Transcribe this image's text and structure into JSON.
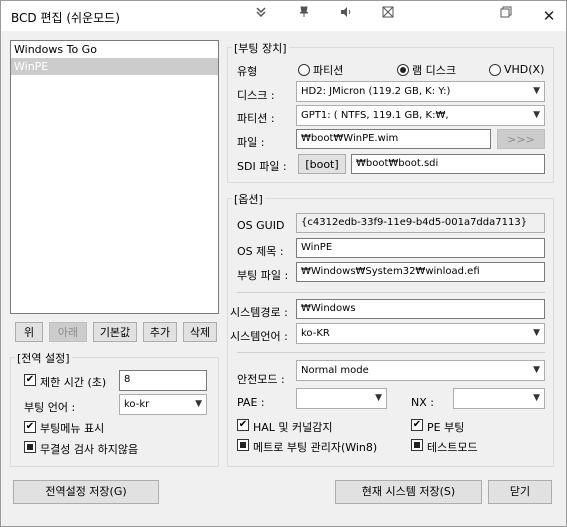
{
  "window": {
    "title": "BCD 편집 (쉬운모드)",
    "close": "✕"
  },
  "toolbar_icons": [
    "double-down-icon",
    "pin-icon",
    "speaker-icon",
    "screen-icon",
    "restore-icon"
  ],
  "entries": [
    "Windows To Go",
    "WinPE"
  ],
  "list_buttons": {
    "up": "위",
    "down": "아래",
    "default": "기본값",
    "add": "추가",
    "delete": "삭제"
  },
  "global_settings": {
    "title": "[전역 설정]",
    "timeout_label": "제한 시간 (초)",
    "timeout_value": "8",
    "lang_label": "부팅 언어 :",
    "lang_value": "ko-kr",
    "show_menu_label": "부팅메뉴 표시",
    "no_integrity_label": "무결성 검사 하지않음"
  },
  "boot_device": {
    "title": "[부팅 장치]",
    "type_label": "유형",
    "type_partition": "파티션",
    "type_ramdisk": "램 디스크",
    "type_vhd": "VHD(X)",
    "disk_label": "디스크 :",
    "disk_value": "HD2: JMicron (119.2 GB, K: Y:)",
    "partition_label": "파티션 :",
    "partition_value": "GPT1: ( NTFS, 119.1 GB, K:₩,",
    "file_label": "파일 :",
    "file_value": "₩boot₩WinPE.wim",
    "browse_label": ">>>",
    "sdi_label": "SDI 파일 :",
    "sdi_button": "[boot]",
    "sdi_value": "₩boot₩boot.sdi"
  },
  "options": {
    "title": "[옵션]",
    "guid_label": "OS GUID",
    "guid_value": "{c4312edb-33f9-11e9-b4d5-001a7dda7113}",
    "os_title_label": "OS 제목 :",
    "os_title_value": "WinPE",
    "boot_file_label": "부팅 파일 :",
    "boot_file_value": "₩Windows₩System32₩winload.efi",
    "sysroot_label": "시스템경로 :",
    "sysroot_value": "₩Windows",
    "syslang_label": "시스템언어 :",
    "syslang_value": "ko-KR",
    "safemode_label": "안전모드 :",
    "safemode_value": "Normal mode",
    "pae_label": "PAE :",
    "pae_value": "",
    "nx_label": "NX :",
    "nx_value": "",
    "hal_label": "HAL 및 커널감지",
    "pe_label": "PE 부팅",
    "metro_label": "메트로 부팅 관리자(Win8)",
    "testmode_label": "테스트모드"
  },
  "footer": {
    "save_global": "전역설정 저장(G)",
    "save_current": "현재 시스템 저장(S)",
    "close": "닫기"
  }
}
